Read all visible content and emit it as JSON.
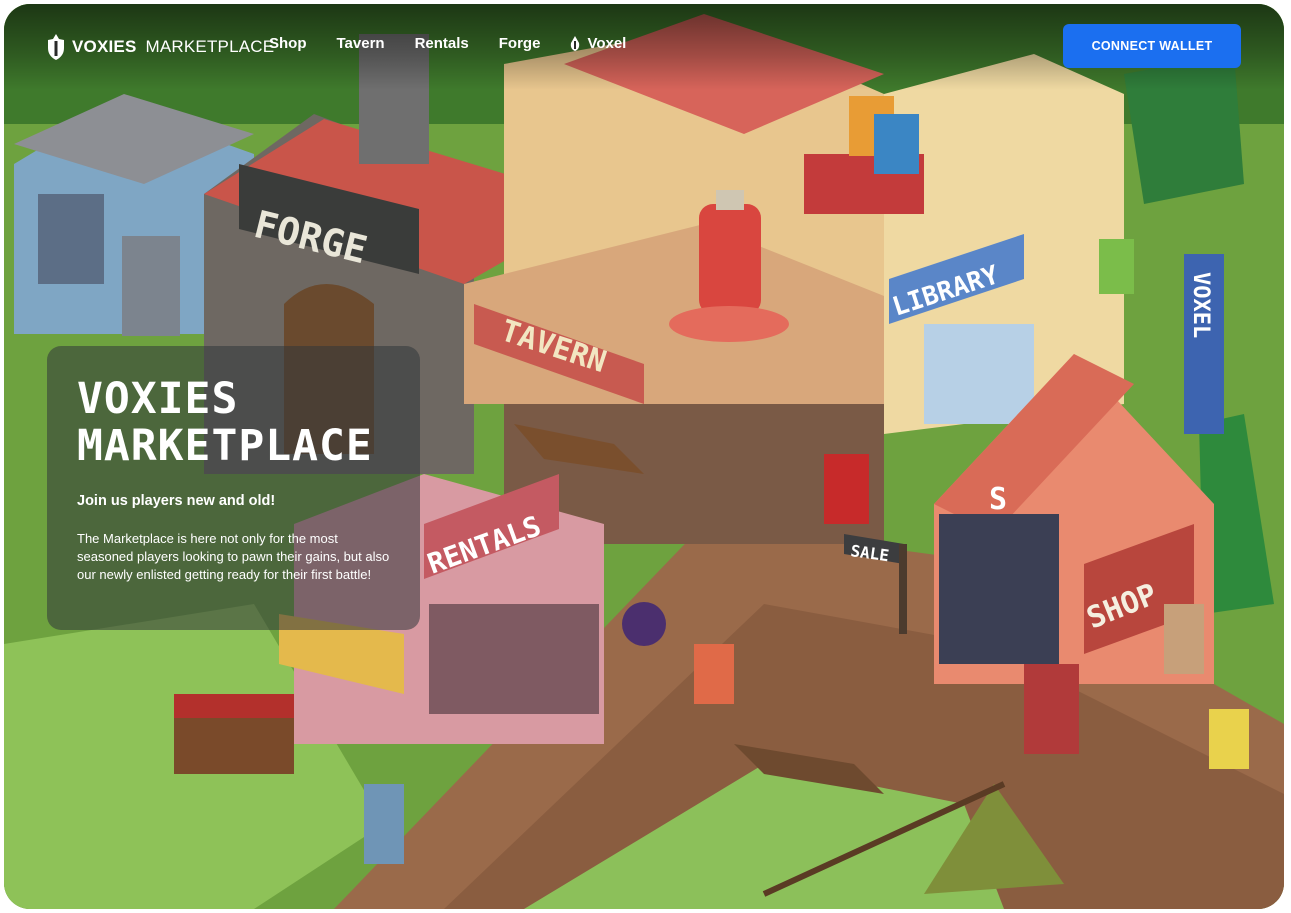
{
  "header": {
    "logo_brand": "VOXIES",
    "logo_suffix": "MARKETPLACE",
    "nav": [
      {
        "label": "Shop"
      },
      {
        "label": "Tavern"
      },
      {
        "label": "Rentals"
      },
      {
        "label": "Forge"
      },
      {
        "label": "Voxel"
      }
    ],
    "connect_wallet": "CONNECT WALLET"
  },
  "hero": {
    "title_line1": "VOXIES",
    "title_line2": "MARKETPLACE",
    "subtitle": "Join us players new and old!",
    "body": "The Marketplace is here not only for the most seasoned players looking to pawn their gains, but also our newly enlisted getting ready for their first battle!"
  },
  "scene": {
    "signs": {
      "forge": "FORGE",
      "tavern": "TAVERN",
      "library": "LIBRARY",
      "rentals": "RENTALS",
      "shop": "SHOP",
      "sale": "SALE",
      "voxel": "VOXEL",
      "shop_letter": "S"
    }
  },
  "colors": {
    "accent": "#1b6ff0",
    "grass": "#6c9a3d",
    "road": "#9a6a4a"
  }
}
